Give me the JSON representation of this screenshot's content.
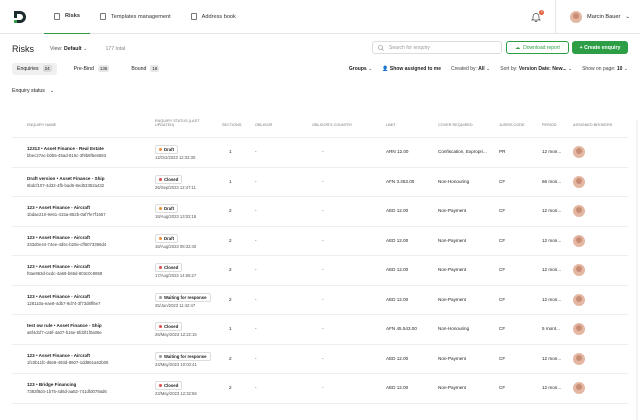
{
  "nav": {
    "tabs": [
      {
        "label": "Risks"
      },
      {
        "label": "Templates management"
      },
      {
        "label": "Address book"
      }
    ],
    "notif_count": "3",
    "user": "Marcin Bauer"
  },
  "header": {
    "title": "Risks",
    "view_label": "View:",
    "view_value": "Default",
    "total": "177 total",
    "search_placeholder": "Search for enquiry",
    "download": "Download report",
    "create": "+ Create enquiry"
  },
  "filters": {
    "tabs": [
      {
        "label": "Enquiries",
        "count": "24"
      },
      {
        "label": "Pre-Bind",
        "count": "135"
      },
      {
        "label": "Bound",
        "count": "18"
      }
    ],
    "groups": "Groups",
    "assigned": "Show assigned to me",
    "created_label": "Created by:",
    "created_value": "All",
    "sort_label": "Sort by:",
    "sort_value": "Version Date: New...",
    "page_label": "Show on page:",
    "page_value": "10"
  },
  "status_filter": "Enquiry status",
  "columns": [
    "Enquiry name",
    "Enquiry status (last updated)",
    "Sections",
    "Obligor",
    "Obligor's country",
    "Limit",
    "Cover required",
    "Jusris code",
    "Period",
    "Assigned brokers"
  ],
  "colors": {
    "accent": "#2e9e46",
    "draft": "#e88f3a",
    "closed": "#e04b4b",
    "waiting": "#9a9a9a"
  },
  "rows": [
    {
      "name": "12313 • Asset Finance - Real Estate",
      "id": "bbec27ac-b0b5-45ad-815c-3f9b8f5e6583",
      "status": "Draft",
      "date": "12/Oct/2023 12:32:30",
      "sections": "1",
      "obligor": "-",
      "country": "-",
      "limit": "ARN 12.00",
      "cover": "Confiscation, Expropri...",
      "code": "PR",
      "period": "12 mon..."
    },
    {
      "name": "Draft version • Asset Finance - Ship",
      "id": "6bdcf107-4d32-4fb-bad6-8ed53352a432",
      "status": "Closed",
      "date": "26/Sep/2023 12:47:11",
      "sections": "1",
      "obligor": "-",
      "country": "-",
      "limit": "AFN 3.453.00",
      "cover": "Non-Honouring",
      "code": "CF",
      "period": "66 mon..."
    },
    {
      "name": "123 • Asset Finance - Aircraft",
      "id": "1bdae210-9e61-415a-852b-0af7fe7f1657",
      "status": "Draft",
      "date": "18/Aug/2023 13:02:18",
      "sections": "2",
      "obligor": "-",
      "country": "-",
      "limit": "AED 12.00",
      "cover": "Non-Payment",
      "code": "CF",
      "period": "12 mon..."
    },
    {
      "name": "123 • Asset Finance - Aircraft",
      "id": "333d0e44-74ee-4d6c-b25e-cff6073396d4",
      "status": "Draft",
      "date": "16/Aug/2023 08:32:40",
      "sections": "2",
      "obligor": "-",
      "country": "-",
      "limit": "AED 12.00",
      "cover": "Non-Payment",
      "code": "CF",
      "period": "12 mon..."
    },
    {
      "name": "123 • Asset Finance - Aircraft",
      "id": "f0ae953d-bcdc-4a69-b65d-803c0c9858",
      "status": "Closed",
      "date": "17/Aug/2023 14:55:27",
      "sections": "2",
      "obligor": "-",
      "country": "-",
      "limit": "AED 12.00",
      "cover": "Non-Payment",
      "code": "CF",
      "period": "12 mon..."
    },
    {
      "name": "123 • Asset Finance - Aircraft",
      "id": "128110a-eae8-4db7-9d74-3f73d8ff6e7",
      "status": "Waiting for response",
      "date": "25/Jun/2023 11:42:47",
      "sections": "2",
      "obligor": "-",
      "country": "-",
      "limit": "AED 12.00",
      "cover": "Non-Payment",
      "code": "CF",
      "period": "12 mon..."
    },
    {
      "name": "test ow rule • Asset Finance - Ship",
      "id": "a6f4d1f7-ca5f-4a07-b16e-5fd3f1f0a06e",
      "status": "Closed",
      "date": "26/May/2023 12:22:15",
      "sections": "1",
      "obligor": "-",
      "country": "-",
      "limit": "AFN 45.543.00",
      "cover": "Non-Honouring",
      "code": "CF",
      "period": "5 mont..."
    },
    {
      "name": "123 • Asset Finance - Aircraft",
      "id": "1fc0b11fc-d8e9-493d-8607-1dd861a62b05",
      "status": "Waiting for response",
      "date": "24/May/2023 10:03:41",
      "sections": "2",
      "obligor": "-",
      "country": "-",
      "limit": "AED 12.00",
      "cover": "Non-Payment",
      "code": "CF",
      "period": "12 mon..."
    },
    {
      "name": "123 • Bridge Financing",
      "id": "7383f8d4-1b75-4d6d-aa82-741dfd079ad6",
      "status": "Closed",
      "date": "23/May/2023 12:32:56",
      "sections": "2",
      "obligor": "-",
      "country": "-",
      "limit": "AED 12.00",
      "cover": "Non-Payment",
      "code": "CF",
      "period": "12 mon..."
    }
  ]
}
